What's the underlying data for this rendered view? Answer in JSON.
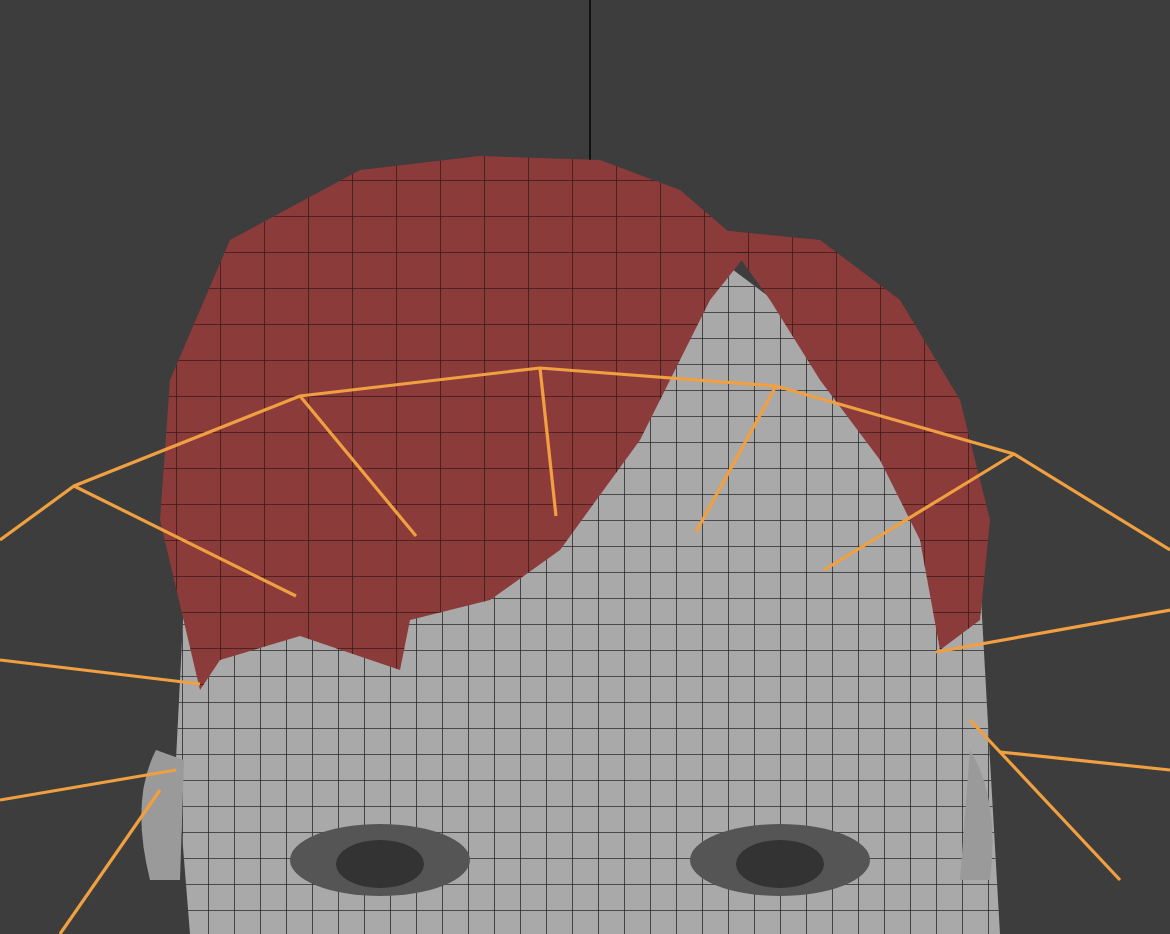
{
  "viewport": {
    "kind": "perspective",
    "wireframe": true,
    "bones": true
  }
}
